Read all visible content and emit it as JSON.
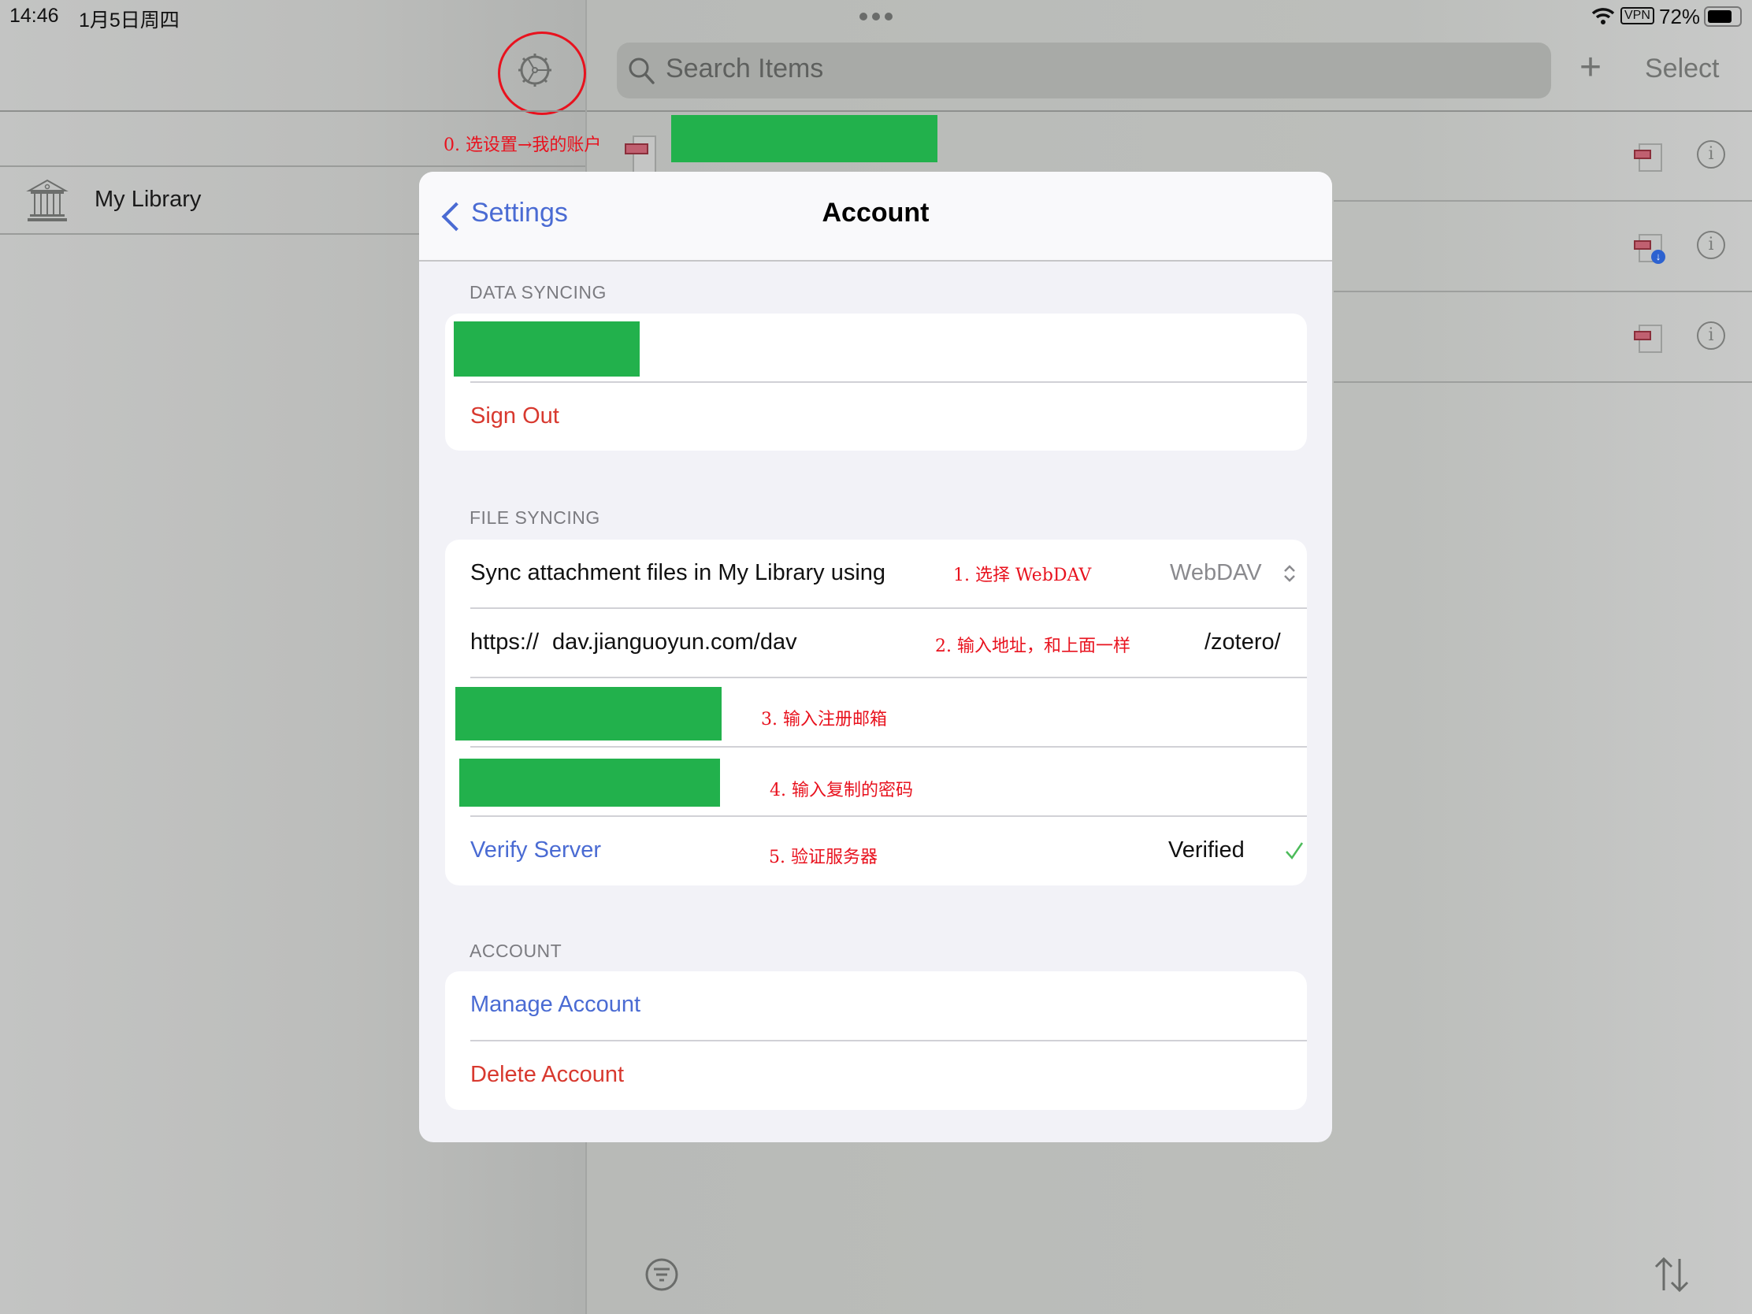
{
  "status_bar": {
    "time": "14:46",
    "date": "1月5日周四",
    "vpn": "VPN",
    "battery": "72%",
    "battery_level": 0.72
  },
  "sidebar": {
    "settings_icon": "gear-icon",
    "items": [
      {
        "label": "My Library",
        "icon": "library-icon"
      }
    ]
  },
  "toolbar": {
    "search_placeholder": "Search Items",
    "add_label": "+",
    "select_label": "Select"
  },
  "items_list": {
    "rows": [
      {
        "attachment": "pdf-icon",
        "download_badge": false,
        "info": "i"
      },
      {
        "attachment": "pdf-icon",
        "download_badge": true,
        "info": "i"
      },
      {
        "attachment": "pdf-icon",
        "download_badge": false,
        "info": "i"
      }
    ]
  },
  "bottom_bar": {
    "filter_icon": "filter-icon",
    "sort_icon": "sort-icon"
  },
  "modal": {
    "back_label": "Settings",
    "title": "Account",
    "sections": {
      "data_syncing": {
        "header": "DATA SYNCING",
        "sign_out": "Sign Out"
      },
      "file_syncing": {
        "header": "FILE SYNCING",
        "sync_label": "Sync attachment files in My Library using",
        "sync_value": "WebDAV",
        "url_prefix": "https://",
        "url_value": "dav.jianguoyun.com/dav",
        "url_suffix": "/zotero/",
        "verify_label": "Verify Server",
        "verified_label": "Verified"
      },
      "account": {
        "header": "ACCOUNT",
        "manage": "Manage Account",
        "delete": "Delete Account"
      }
    }
  },
  "annotations": {
    "step0": "0. 选设置→我的账户",
    "step1": "1. 选择 WebDAV",
    "step2": "2. 输入地址，和上面一样",
    "step3": "3. 输入注册邮箱",
    "step4": "4. 输入复制的密码",
    "step5": "5. 验证服务器"
  },
  "colors": {
    "accent_blue": "#4a6bd3",
    "destructive_red": "#d8392f",
    "annotation_red": "#e8121e",
    "redaction_green": "#22b14c",
    "verified_green": "#4cbb5a"
  }
}
